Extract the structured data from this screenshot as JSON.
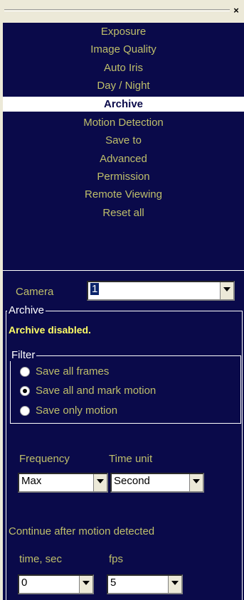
{
  "window": {
    "close_glyph": "×"
  },
  "menu": {
    "items": [
      {
        "label": "Exposure",
        "selected": false
      },
      {
        "label": "Image Quality",
        "selected": false
      },
      {
        "label": "Auto Iris",
        "selected": false
      },
      {
        "label": "Day / Night",
        "selected": false
      },
      {
        "label": "Archive",
        "selected": true
      },
      {
        "label": "Motion Detection",
        "selected": false
      },
      {
        "label": "Save to",
        "selected": false
      },
      {
        "label": "Advanced",
        "selected": false
      },
      {
        "label": "Permission",
        "selected": false
      },
      {
        "label": "Remote Viewing",
        "selected": false
      },
      {
        "label": "Reset all",
        "selected": false
      }
    ]
  },
  "camera": {
    "label": "Camera",
    "value": "1"
  },
  "archive": {
    "title": "Archive",
    "status": "Archive disabled.",
    "filter": {
      "title": "Filter",
      "options": [
        {
          "label": "Save all frames",
          "checked": false
        },
        {
          "label": "Save all and mark motion",
          "checked": true
        },
        {
          "label": "Save only motion",
          "checked": false
        }
      ]
    },
    "frequency": {
      "label": "Frequency",
      "value": "Max"
    },
    "time_unit": {
      "label": "Time unit",
      "value": "Second"
    },
    "continue_label": "Continue after motion detected",
    "time_sec": {
      "label": "time, sec",
      "value": "0"
    },
    "fps": {
      "label": "fps",
      "value": "5"
    }
  },
  "colors": {
    "background": "#0a0a4a",
    "text": "#bfbf6a",
    "status": "#ffff66",
    "selected_bg": "#ffffff"
  }
}
